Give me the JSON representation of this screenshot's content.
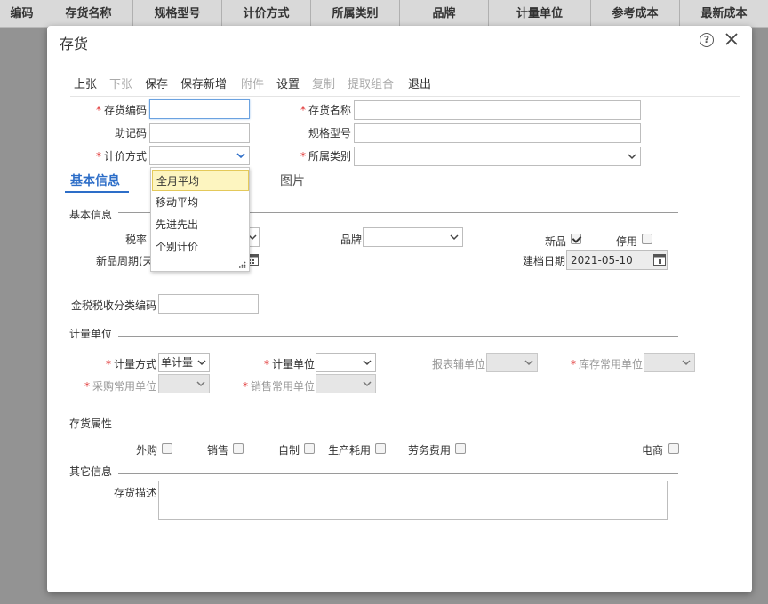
{
  "grid": {
    "columns": [
      "编码",
      "存货名称",
      "规格型号",
      "计价方式",
      "所属类别",
      "品牌",
      "计量单位",
      "参考成本",
      "最新成本"
    ]
  },
  "dialog": {
    "title": "存货",
    "toolbar": [
      {
        "label": "上张",
        "enabled": true
      },
      {
        "label": "下张",
        "enabled": false
      },
      {
        "label": "保存",
        "enabled": true
      },
      {
        "label": "保存新增",
        "enabled": true
      },
      {
        "label": "附件",
        "enabled": false
      },
      {
        "label": "设置",
        "enabled": true
      },
      {
        "label": "复制",
        "enabled": false
      },
      {
        "label": "提取组合",
        "enabled": false
      },
      {
        "label": "退出",
        "enabled": true
      }
    ]
  },
  "form": {
    "code_label": "存货编码",
    "code_value": "",
    "name_label": "存货名称",
    "name_value": "",
    "mnemonic_label": "助记码",
    "mnemonic_value": "",
    "spec_label": "规格型号",
    "spec_value": "",
    "pricing_label": "计价方式",
    "pricing_value": "",
    "category_label": "所属类别",
    "category_value": ""
  },
  "tabs": [
    "基本信息",
    "图片"
  ],
  "basic": {
    "section_title": "基本信息",
    "tax_label": "税率",
    "brand_label": "品牌",
    "brand_value": "",
    "new_label": "新品",
    "new_checked": true,
    "disable_label": "停用",
    "disable_checked": false,
    "new_period_label": "新品周期(天",
    "create_date_label": "建档日期",
    "create_date_value": "2021-05-10",
    "tax_code_label": "金税税收分类编码",
    "tax_code_value": ""
  },
  "unit": {
    "section_title": "计量单位",
    "method_label": "计量方式",
    "method_value": "单计量",
    "unit_label": "计量单位",
    "unit_value": "",
    "report_aux_label": "报表辅单位",
    "stock_unit_label": "库存常用单位",
    "purchase_unit_label": "采购常用单位",
    "sales_unit_label": "销售常用单位"
  },
  "attributes": {
    "section_title": "存货属性",
    "items": [
      {
        "label": "外购",
        "checked": false
      },
      {
        "label": "销售",
        "checked": false
      },
      {
        "label": "自制",
        "checked": false
      },
      {
        "label": "生产耗用",
        "checked": false
      },
      {
        "label": "劳务费用",
        "checked": false
      },
      {
        "label": "电商",
        "checked": false
      }
    ]
  },
  "other": {
    "section_title": "其它信息",
    "desc_label": "存货描述",
    "desc_value": ""
  },
  "pricing_dropdown": {
    "options": [
      "全月平均",
      "移动平均",
      "先进先出",
      "个别计价"
    ],
    "highlighted": "全月平均"
  },
  "icons": {
    "help": "help-circle-icon",
    "close": "close-icon",
    "calendar": "calendar-icon",
    "dropdown_arrow": "chevron-down-icon"
  },
  "colors": {
    "accent": "#2d6ec8",
    "required": "#e03030",
    "highlight": "#fdf5c0"
  }
}
